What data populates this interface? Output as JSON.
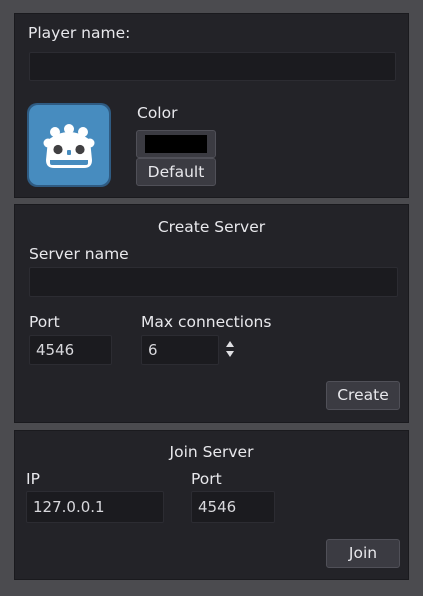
{
  "player": {
    "name_label": "Player name:",
    "name_value": "",
    "color_label": "Color",
    "color_value": "#000000",
    "default_button": "Default"
  },
  "create_server": {
    "title": "Create Server",
    "server_name_label": "Server name",
    "server_name_value": "",
    "port_label": "Port",
    "port_value": "4546",
    "max_connections_label": "Max connections",
    "max_connections_value": "6",
    "create_button": "Create"
  },
  "join_server": {
    "title": "Join Server",
    "ip_label": "IP",
    "ip_value": "127.0.0.1",
    "port_label": "Port",
    "port_value": "4546",
    "join_button": "Join"
  },
  "colors": {
    "panel": "#232328",
    "background": "#4b4b4f",
    "godot_icon": "#478cbf"
  }
}
